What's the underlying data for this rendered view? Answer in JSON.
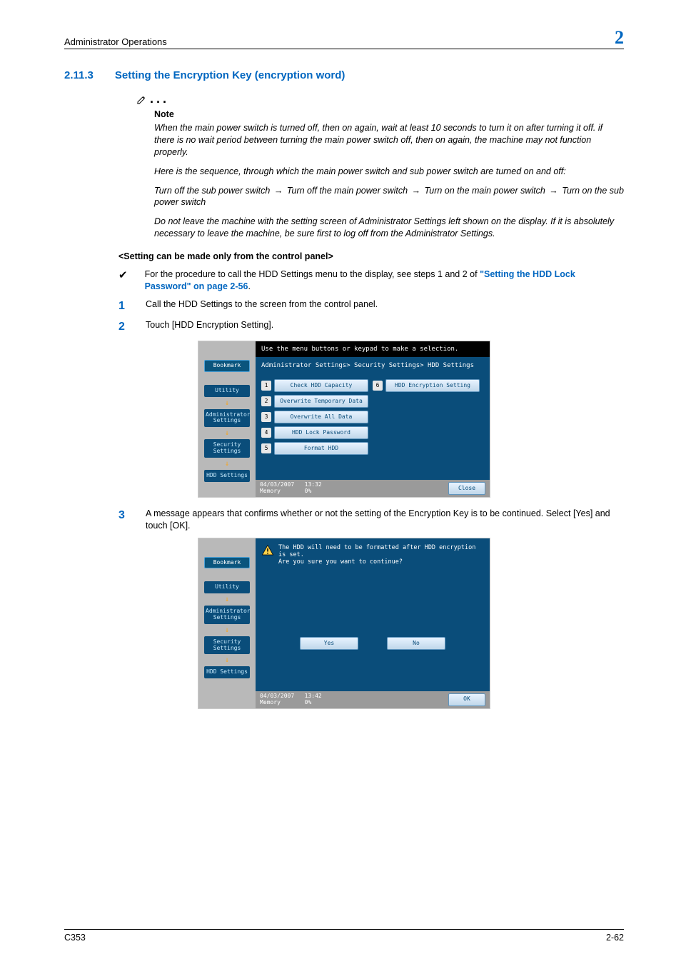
{
  "header": {
    "left": "Administrator Operations",
    "chapter": "2"
  },
  "section": {
    "num": "2.11.3",
    "title": "Setting the Encryption Key (encryption word)"
  },
  "note": {
    "label": "Note",
    "p1": "When the main power switch is turned off, then on again, wait at least 10 seconds to turn it on after turning it off. if there is no wait period between turning the main power switch off, then on again, the machine may not function properly.",
    "p2": "Here is the sequence, through which the main power switch and sub power switch are turned on and off:",
    "p3a": "Turn off the sub power switch ",
    "p3b": " Turn off the main power switch ",
    "p3c": " Turn on the main power switch ",
    "p3d": " Turn on the sub power switch",
    "p4": "Do not leave the machine with the setting screen of Administrator Settings left shown on the display. If it is absolutely necessary to leave the machine, be sure first to log off from the Administrator Settings."
  },
  "subhead": "<Setting can be made only from the control panel>",
  "bullet": {
    "text": "For the procedure to call the HDD Settings menu to the display, see steps 1 and 2 of ",
    "link": "\"Setting the HDD Lock Password\" on page 2-56",
    "after": "."
  },
  "steps": {
    "s1": "Call the HDD Settings to the screen from the control panel.",
    "s2": "Touch [HDD Encryption Setting].",
    "s3": "A message appears that confirms whether or not the setting of the Encryption Key is to be continued. Select [Yes] and touch [OK]."
  },
  "panel1": {
    "msg": "Use the menu buttons or keypad to make a selection.",
    "breadcrumb": "Administrator Settings> Security Settings> HDD Settings",
    "nav": {
      "bookmark": "Bookmark",
      "utility": "Utility",
      "admin": "Administrator Settings",
      "security": "Security Settings",
      "hdd": "HDD Settings"
    },
    "items": [
      {
        "n": "1",
        "label": "Check HDD Capacity"
      },
      {
        "n": "2",
        "label": "Overwrite Temporary Data"
      },
      {
        "n": "3",
        "label": "Overwrite All Data"
      },
      {
        "n": "4",
        "label": "HDD Lock Password"
      },
      {
        "n": "5",
        "label": "Format HDD"
      }
    ],
    "item6": {
      "n": "6",
      "label": "HDD Encryption Setting"
    },
    "close": "Close",
    "date": "04/03/2007",
    "time": "13:32",
    "mem": "Memory",
    "memval": "0%"
  },
  "panel2": {
    "msg1": "The HDD will need to be formatted after HDD encryption is set.",
    "msg2": "Are you sure you want to continue?",
    "yes": "Yes",
    "no": "No",
    "ok": "OK",
    "date": "04/03/2007",
    "time": "13:42",
    "mem": "Memory",
    "memval": "0%"
  },
  "footer": {
    "model": "C353",
    "page": "2-62"
  }
}
